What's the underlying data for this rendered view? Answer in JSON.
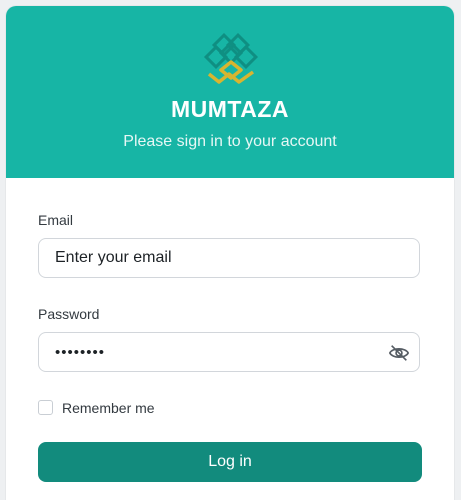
{
  "header": {
    "brand": "MUMTAZA",
    "subtitle": "Please sign in to your account",
    "logo_icon": "mumtaza-logo",
    "bg_color": "#17b5a5"
  },
  "form": {
    "email_label": "Email",
    "email_placeholder": "Enter your email",
    "password_label": "Password",
    "password_value": "••••••••",
    "password_toggle_icon": "eye-off-icon",
    "remember_label": "Remember me",
    "remember_checked": false,
    "login_label": "Log in",
    "login_color": "#128b7d"
  }
}
